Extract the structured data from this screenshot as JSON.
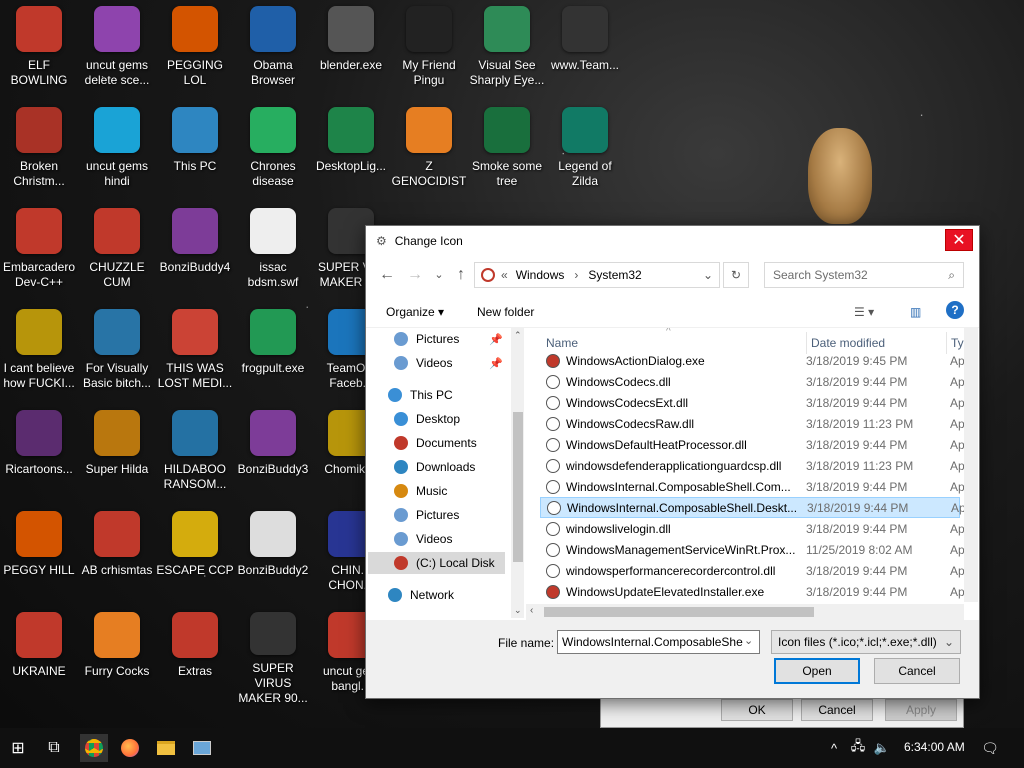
{
  "desktop_icons": [
    {
      "label": "ELF BOWLING",
      "icon": "elf-bowling-icon",
      "color": "#c0392b"
    },
    {
      "label": "uncut gems delete sce...",
      "icon": "gem-icon",
      "color": "#8e44ad"
    },
    {
      "label": "PEGGING LOL",
      "icon": "pegging-icon",
      "color": "#d35400"
    },
    {
      "label": "Obama Browser",
      "icon": "obama-icon",
      "color": "#1f5fa8"
    },
    {
      "label": "blender.exe",
      "icon": "blender-icon",
      "color": "#555555"
    },
    {
      "label": "My Friend Pingu",
      "icon": "penguin-icon",
      "color": "#222222"
    },
    {
      "label": "Visual See Sharply Eye...",
      "icon": "csharp-icon",
      "color": "#2e8b57"
    },
    {
      "label": "www.Team...",
      "icon": "file-icon",
      "color": "#333333"
    },
    {
      "label": "Broken Christm...",
      "icon": "ornament-icon",
      "color": "#a93226"
    },
    {
      "label": "uncut gems hindi",
      "icon": "gem-icon",
      "color": "#1aa3d6"
    },
    {
      "label": "This PC",
      "icon": "computer-icon",
      "color": "#2e86c1"
    },
    {
      "label": "Chrones disease",
      "icon": "chrome-icon",
      "color": "#27ae60"
    },
    {
      "label": "DesktopLig...",
      "icon": "tree-icon",
      "color": "#1e8449"
    },
    {
      "label": "Z GENOCIDIST",
      "icon": "z-icon",
      "color": "#e67e22"
    },
    {
      "label": "Smoke some tree",
      "icon": "tree-icon",
      "color": "#196f3d"
    },
    {
      "label": "Legend of Zilda",
      "icon": "link-icon",
      "color": "#117a65"
    },
    {
      "label": "Embarcadero Dev-C++",
      "icon": "devcpp-icon",
      "color": "#c0392b"
    },
    {
      "label": "CHUZZLE CUM",
      "icon": "chuzzle-icon",
      "color": "#c0392b"
    },
    {
      "label": "BonziBuddy4",
      "icon": "gorilla-icon",
      "color": "#7d3c98"
    },
    {
      "label": "issac bdsm.swf",
      "icon": "flash-icon",
      "color": "#eeeeee"
    },
    {
      "label": "SUPER VI... MAKER 9...",
      "icon": "virus-icon",
      "color": "#333333"
    },
    {
      "label": "I cant believe how FUCKI...",
      "icon": "witch-icon",
      "color": "#b7950b"
    },
    {
      "label": "For Visually Basic bitch...",
      "icon": "vb-icon",
      "color": "#2874a6"
    },
    {
      "label": "THIS WAS LOST MEDI...",
      "icon": "colorful-icon",
      "color": "#cb4335"
    },
    {
      "label": "frogpult.exe",
      "icon": "frog-icon",
      "color": "#229954"
    },
    {
      "label": "TeamO... Faceb...",
      "icon": "gear-icon",
      "color": "#1b75bc"
    },
    {
      "label": "Ricartoons...",
      "icon": "ninja-icon",
      "color": "#5b2c6f"
    },
    {
      "label": "Super Hilda",
      "icon": "pixel-icon",
      "color": "#b9770e"
    },
    {
      "label": "HILDABOO RANSOM...",
      "icon": "snake-icon",
      "color": "#2471a3"
    },
    {
      "label": "BonziBuddy3",
      "icon": "gorilla-icon",
      "color": "#7d3c98"
    },
    {
      "label": "Chomikl...",
      "icon": "bo-icon",
      "color": "#b7950b"
    },
    {
      "label": "PEGGY HILL",
      "icon": "peggy-icon",
      "color": "#d35400"
    },
    {
      "label": "AB crhismtas",
      "icon": "angry-bird-icon",
      "color": "#c0392b"
    },
    {
      "label": "ESCAPE CCP",
      "icon": "mahjong-icon",
      "color": "#d4ac0d"
    },
    {
      "label": "BonziBuddy2",
      "icon": "file-icon",
      "color": "#dddddd"
    },
    {
      "label": "CHIN... CHON...",
      "icon": "ball-icon",
      "color": "#283593"
    },
    {
      "label": "UKRAINE",
      "icon": "radiation-icon",
      "color": "#c0392b"
    },
    {
      "label": "Furry Cocks",
      "icon": "firefox-icon",
      "color": "#e67e22"
    },
    {
      "label": "Extras",
      "icon": "box-icon",
      "color": "#c0392b"
    },
    {
      "label": "SUPER VIRUS MAKER 90...",
      "icon": "virus-icon",
      "color": "#333333"
    },
    {
      "label": "uncut ge... bangl...",
      "icon": "gem-icon",
      "color": "#c0392b"
    }
  ],
  "dialog": {
    "title": "Change Icon",
    "close_glyph": "✕",
    "breadcrumb": [
      "Windows",
      "System32"
    ],
    "breadcrumb_prefix": "«",
    "search_placeholder": "Search System32",
    "organize_label": "Organize ▾",
    "new_folder_label": "New folder",
    "nav_tree": [
      {
        "label": "Pictures",
        "icon": "pictures-icon",
        "color": "#6a9bd1",
        "pinned": true
      },
      {
        "label": "Videos",
        "icon": "videos-icon",
        "color": "#6a9bd1",
        "pinned": true
      },
      {
        "label": "This PC",
        "icon": "computer-icon",
        "color": "#3a8fd6",
        "pinned": false
      },
      {
        "label": "Desktop",
        "icon": "desktop-icon",
        "color": "#3a8fd6",
        "pinned": false
      },
      {
        "label": "Documents",
        "icon": "documents-icon",
        "color": "#c0392b",
        "pinned": false
      },
      {
        "label": "Downloads",
        "icon": "downloads-icon",
        "color": "#2e86c1",
        "pinned": false
      },
      {
        "label": "Music",
        "icon": "music-icon",
        "color": "#d68910",
        "pinned": false
      },
      {
        "label": "Pictures",
        "icon": "pictures-icon",
        "color": "#6a9bd1",
        "pinned": false
      },
      {
        "label": "Videos",
        "icon": "videos-icon",
        "color": "#6a9bd1",
        "pinned": false
      },
      {
        "label": "(C:) Local Disk",
        "icon": "disk-icon",
        "color": "#c0392b",
        "pinned": false
      },
      {
        "label": "Network",
        "icon": "network-icon",
        "color": "#2e86c1",
        "pinned": false
      }
    ],
    "columns": {
      "name": "Name",
      "date": "Date modified",
      "type": "Ty"
    },
    "files": [
      {
        "name": "WindowsActionDialog.exe",
        "date": "3/18/2019 9:45 PM",
        "type": "Ap"
      },
      {
        "name": "WindowsCodecs.dll",
        "date": "3/18/2019 9:44 PM",
        "type": "Ap"
      },
      {
        "name": "WindowsCodecsExt.dll",
        "date": "3/18/2019 9:44 PM",
        "type": "Ap"
      },
      {
        "name": "WindowsCodecsRaw.dll",
        "date": "3/18/2019 11:23 PM",
        "type": "Ap"
      },
      {
        "name": "WindowsDefaultHeatProcessor.dll",
        "date": "3/18/2019 9:44 PM",
        "type": "Ap"
      },
      {
        "name": "windowsdefenderapplicationguardcsp.dll",
        "date": "3/18/2019 11:23 PM",
        "type": "Ap"
      },
      {
        "name": "WindowsInternal.ComposableShell.Com...",
        "date": "3/18/2019 9:44 PM",
        "type": "Ap"
      },
      {
        "name": "WindowsInternal.ComposableShell.Deskt...",
        "date": "3/18/2019 9:44 PM",
        "type": "Ap"
      },
      {
        "name": "windowslivelogin.dll",
        "date": "3/18/2019 9:44 PM",
        "type": "Ap"
      },
      {
        "name": "WindowsManagementServiceWinRt.Prox...",
        "date": "11/25/2019 8:02 AM",
        "type": "Ap"
      },
      {
        "name": "windowsperformancerecordercontrol.dll",
        "date": "3/18/2019 9:44 PM",
        "type": "Ap"
      },
      {
        "name": "WindowsUpdateElevatedInstaller.exe",
        "date": "3/18/2019 9:44 PM",
        "type": "Ap"
      }
    ],
    "file_name_label": "File name:",
    "file_name_value": "WindowsInternal.ComposableShe",
    "file_type_value": "Icon files (*.ico;*.icl;*.exe;*.dll)",
    "open_label": "Open",
    "cancel_label": "Cancel"
  },
  "back_dialog": {
    "ok_label": "OK",
    "cancel_label": "Cancel",
    "apply_label": "Apply"
  },
  "taskbar": {
    "start_glyph": "⊞",
    "task_view_glyph": "⧉",
    "chevron_glyph": "^",
    "network_glyph": "🖧",
    "volume_glyph": "🔈",
    "notification_glyph": "🗨",
    "time": "6:34:00 AM"
  }
}
